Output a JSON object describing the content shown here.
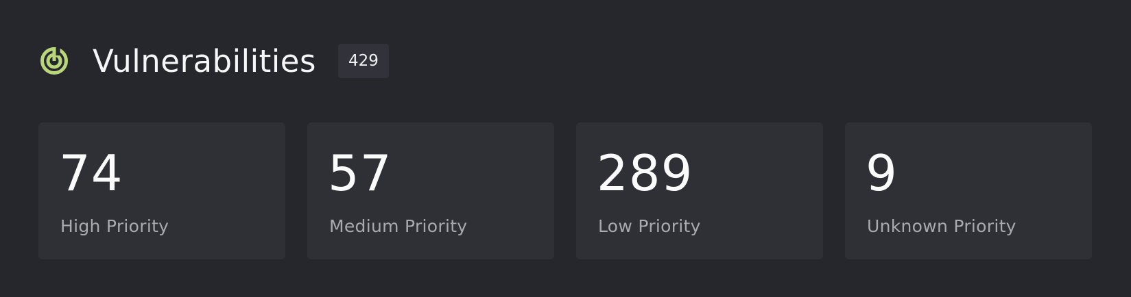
{
  "header": {
    "icon": "radar-icon",
    "title": "Vulnerabilities",
    "count": "429"
  },
  "cards": [
    {
      "value": "74",
      "label": "High Priority"
    },
    {
      "value": "57",
      "label": "Medium Priority"
    },
    {
      "value": "289",
      "label": "Low Priority"
    },
    {
      "value": "9",
      "label": "Unknown Priority"
    }
  ],
  "colors": {
    "background": "#26272c",
    "card": "#2f3035",
    "accent": "#b9d77a",
    "label": "#a9aab0"
  }
}
